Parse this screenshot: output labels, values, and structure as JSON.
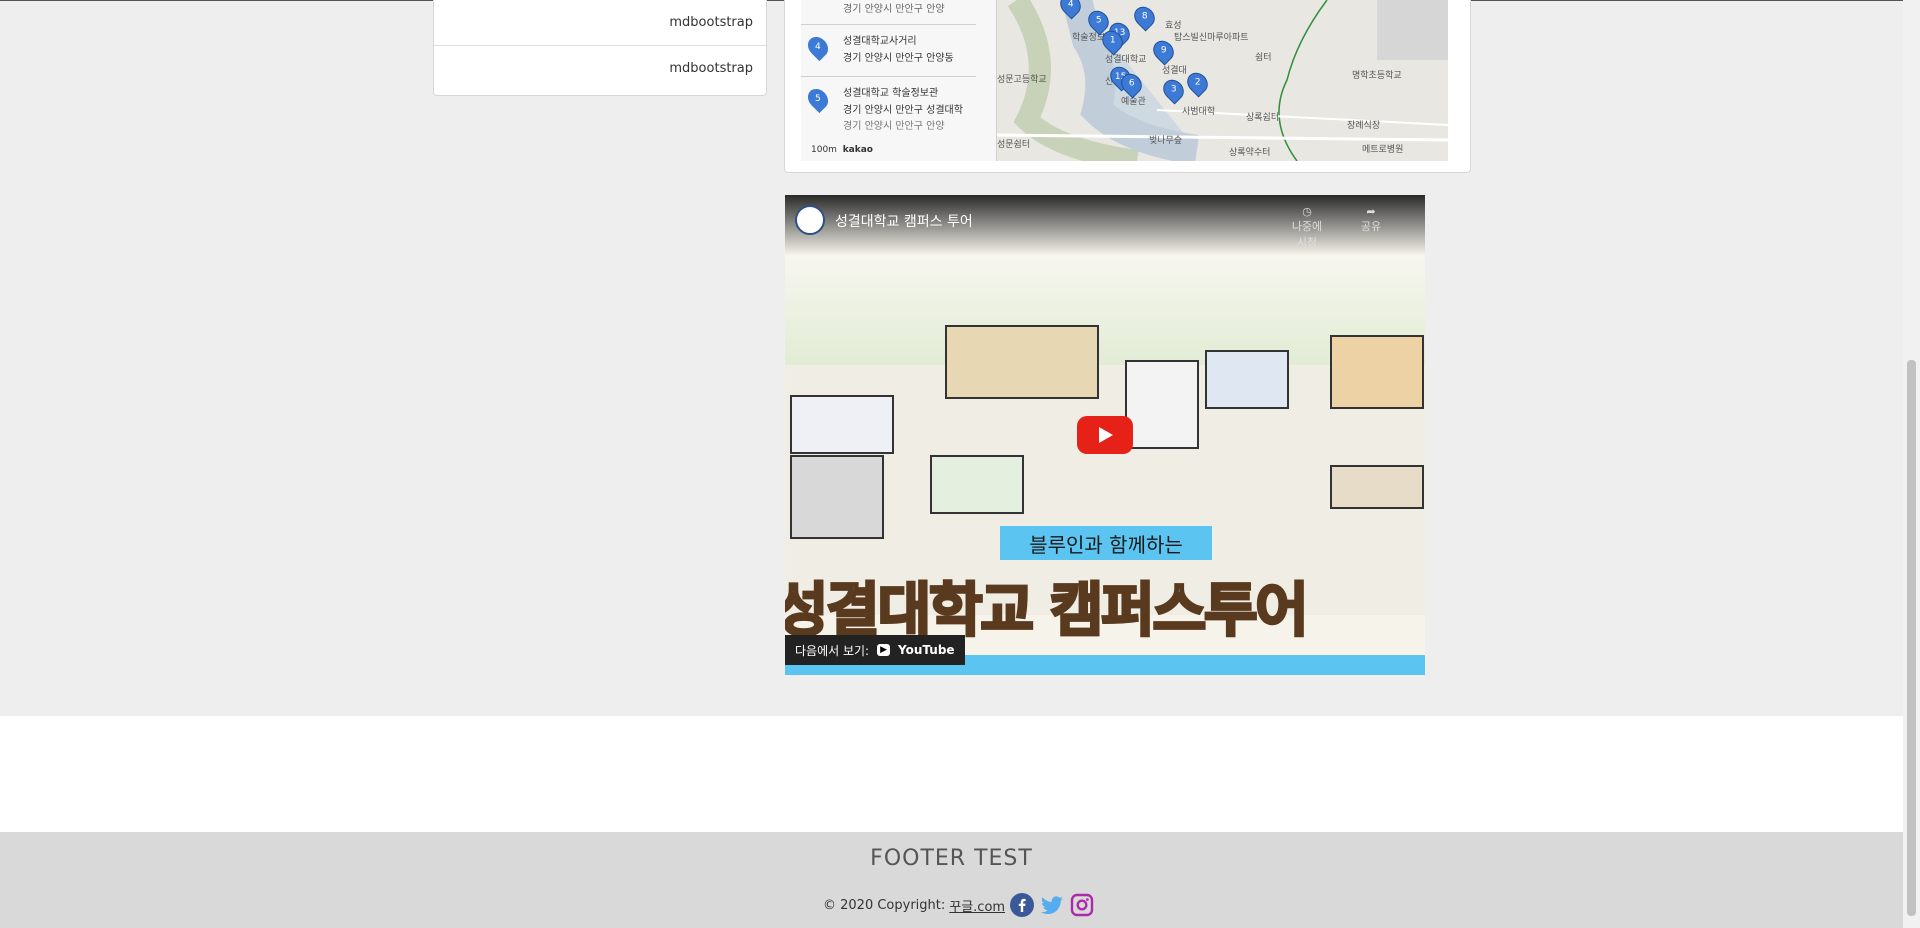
{
  "left_list": {
    "items": [
      "mdbootstrap",
      "mdbootstrap"
    ]
  },
  "map": {
    "entries": [
      {
        "marker": "",
        "title": "",
        "address": "경기 안양시 만안구 안양"
      },
      {
        "marker": "4",
        "title": "성결대학교사거리",
        "address": "경기 안양시 만안구 안양동"
      },
      {
        "marker": "5",
        "title": "성결대학교 학술정보관",
        "address": "경기 안양시 만안구 성결대학"
      },
      {
        "marker": "",
        "title": "",
        "address": "경기 안양시 만안구 안양"
      }
    ],
    "area_labels": [
      "탑스빌신마루아파트",
      "학술정보",
      "성결대학교",
      "성결대",
      "예술관",
      "사범대학",
      "성문고등학교",
      "신학",
      "상록쉼터",
      "명학초등학교",
      "장례식장",
      "메트로병원",
      "상록약수터",
      "벚나무숲",
      "성문쉼터",
      "쉼터",
      "효성"
    ],
    "pins": [
      "8",
      "5",
      "13",
      "1",
      "9",
      "2",
      "3",
      "15",
      "6",
      "4"
    ],
    "scale_text": "100m",
    "brand": "kakao"
  },
  "video": {
    "title": "성결대학교 캠퍼스 투어",
    "watch_later": "나중에 시청",
    "share": "공유",
    "subtitle": "블루인과 함께하는",
    "big_title": "성결대학교 캠퍼스투어",
    "watch_on": "다음에서 보기:",
    "youtube": "YouTube"
  },
  "footer": {
    "title": "FOOTER TEST",
    "copyright": "© 2020 Copyright:",
    "link": "꾸글.com",
    "social": [
      "facebook-icon",
      "twitter-icon",
      "instagram-icon"
    ],
    "colors": {
      "facebook": "#3b5998",
      "twitter": "#55acee",
      "instagram": "#ac2bac"
    }
  }
}
